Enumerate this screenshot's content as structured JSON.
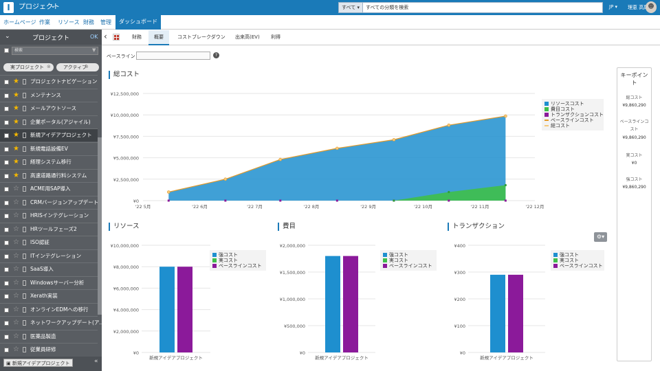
{
  "header": {
    "logo": "I",
    "app_title": "プロジェクト",
    "scope": "すべて ▾",
    "search_placeholder": "すべての分類を検索",
    "lang": "JP ▾",
    "user": "理恵 高尾"
  },
  "nav": [
    "ホームページ",
    "作業",
    "リソース",
    "財務",
    "管理",
    "ダッシュボード"
  ],
  "sidebar": {
    "title": "プロジェクト",
    "ok": "OK",
    "filter_placeholder": "検索",
    "tags": [
      "実プロジェクト",
      "アクティブ"
    ],
    "items": [
      {
        "label": "プロジェクトナビゲーション",
        "star": true
      },
      {
        "label": "メンテナンス",
        "star": true
      },
      {
        "label": "メールアウトソース",
        "star": true
      },
      {
        "label": "企業ポータル(アジャイル)",
        "star": true
      },
      {
        "label": "新規アイデアプロジェクト",
        "star": true,
        "selected": true
      },
      {
        "label": "新規電話設備EV",
        "star": true
      },
      {
        "label": "経理システム移行",
        "star": true
      },
      {
        "label": "高速道路通行料システム",
        "star": true
      },
      {
        "label": "ACME用SAP導入",
        "star": false
      },
      {
        "label": "CRMバージョンアップデート",
        "star": false
      },
      {
        "label": "HRISインテグレーション",
        "star": false
      },
      {
        "label": "HRツールフェーズ2",
        "star": false
      },
      {
        "label": "ISO認証",
        "star": false
      },
      {
        "label": "ITインテグレーション",
        "star": false
      },
      {
        "label": "SaaS導入",
        "star": false
      },
      {
        "label": "Windowsサーバー分析",
        "star": false
      },
      {
        "label": "Xerath実装",
        "star": false
      },
      {
        "label": "オンラインEDMへの移行",
        "star": false
      },
      {
        "label": "ネットワークアップデート(ア...",
        "star": false
      },
      {
        "label": "医薬品製造",
        "star": false
      },
      {
        "label": "従業員研修",
        "star": false
      }
    ],
    "footer": "新規アイデアプロジェクト"
  },
  "tabs": [
    "財務",
    "概要",
    "コストブレークダウン",
    "出来高(EV)",
    "利得"
  ],
  "active_tab": "概要",
  "baseline_label": "ベースライン",
  "keypoints": {
    "title": "キーポイント",
    "items": [
      {
        "label": "総コスト",
        "value": "¥9,860,290"
      },
      {
        "label": "ベースラインコスト",
        "value": "¥9,860,290"
      },
      {
        "label": "実コスト",
        "value": "¥0"
      },
      {
        "label": "強コスト",
        "value": "¥9,860,290"
      }
    ]
  },
  "colors": {
    "resource": "#1e8fcf",
    "expense": "#3fbf4a",
    "transaction": "#8b1a9a",
    "baseline": "#e39a2a",
    "total": "#f5c97a",
    "accent": "#1a7ab8"
  },
  "chart_data": [
    {
      "type": "area",
      "title": "総コスト",
      "x": [
        "'22 5月",
        "'22 6月",
        "'22 7月",
        "'22 8月",
        "'22 9月",
        "'22 10月",
        "'22 11月",
        "'22 12月"
      ],
      "point_dates": [
        "2022-05-15",
        "2022-06-15",
        "2022-07-15",
        "2022-08-15",
        "2022-09-15",
        "2022-10-15",
        "2022-11-15"
      ],
      "ylim": [
        0,
        12500000
      ],
      "yticks": [
        "¥12,500,000",
        "¥10,000,000",
        "¥7,500,000",
        "¥5,000,000",
        "¥2,500,000",
        "¥0"
      ],
      "series": [
        {
          "name": "リソースコスト",
          "values": [
            1000000,
            2500000,
            4800000,
            6100000,
            7100000,
            8800000,
            9860290
          ]
        },
        {
          "name": "費目コスト",
          "values": [
            0,
            0,
            0,
            0,
            0,
            1000000,
            1800000
          ]
        },
        {
          "name": "トランザクションコスト",
          "values": [
            0,
            0,
            0,
            0,
            0,
            0,
            0
          ]
        },
        {
          "name": "ベースラインコスト",
          "values": [
            1000000,
            2500000,
            4800000,
            6100000,
            7100000,
            8800000,
            9860290
          ]
        },
        {
          "name": "総コスト",
          "values": [
            1000000,
            2500000,
            4800000,
            6100000,
            7100000,
            8800000,
            9860290
          ]
        }
      ]
    },
    {
      "type": "bar",
      "title": "リソース",
      "categories": [
        "新規アイデアプロジェクト"
      ],
      "ylim": [
        0,
        10000000
      ],
      "yticks": [
        "¥10,000,000",
        "¥8,000,000",
        "¥6,000,000",
        "¥4,000,000",
        "¥2,000,000",
        "¥0"
      ],
      "series": [
        {
          "name": "強コスト",
          "values": [
            8000000
          ]
        },
        {
          "name": "実コスト",
          "values": [
            0
          ]
        },
        {
          "name": "ベースラインコスト",
          "values": [
            8000000
          ]
        }
      ]
    },
    {
      "type": "bar",
      "title": "費目",
      "categories": [
        "新規アイデアプロジェクト"
      ],
      "ylim": [
        0,
        2000000
      ],
      "yticks": [
        "¥2,000,000",
        "¥1,500,000",
        "¥1,000,000",
        "¥500,000",
        "¥0"
      ],
      "series": [
        {
          "name": "強コスト",
          "values": [
            1800000
          ]
        },
        {
          "name": "実コスト",
          "values": [
            0
          ]
        },
        {
          "name": "ベースラインコスト",
          "values": [
            1800000
          ]
        }
      ]
    },
    {
      "type": "bar",
      "title": "トランザクション",
      "categories": [
        "新規アイデアプロジェクト"
      ],
      "ylim": [
        0,
        400
      ],
      "yticks": [
        "¥400",
        "¥300",
        "¥200",
        "¥100",
        "¥0"
      ],
      "series": [
        {
          "name": "強コスト",
          "values": [
            290
          ]
        },
        {
          "name": "実コスト",
          "values": [
            0
          ]
        },
        {
          "name": "ベースラインコスト",
          "values": [
            290
          ]
        }
      ]
    }
  ]
}
